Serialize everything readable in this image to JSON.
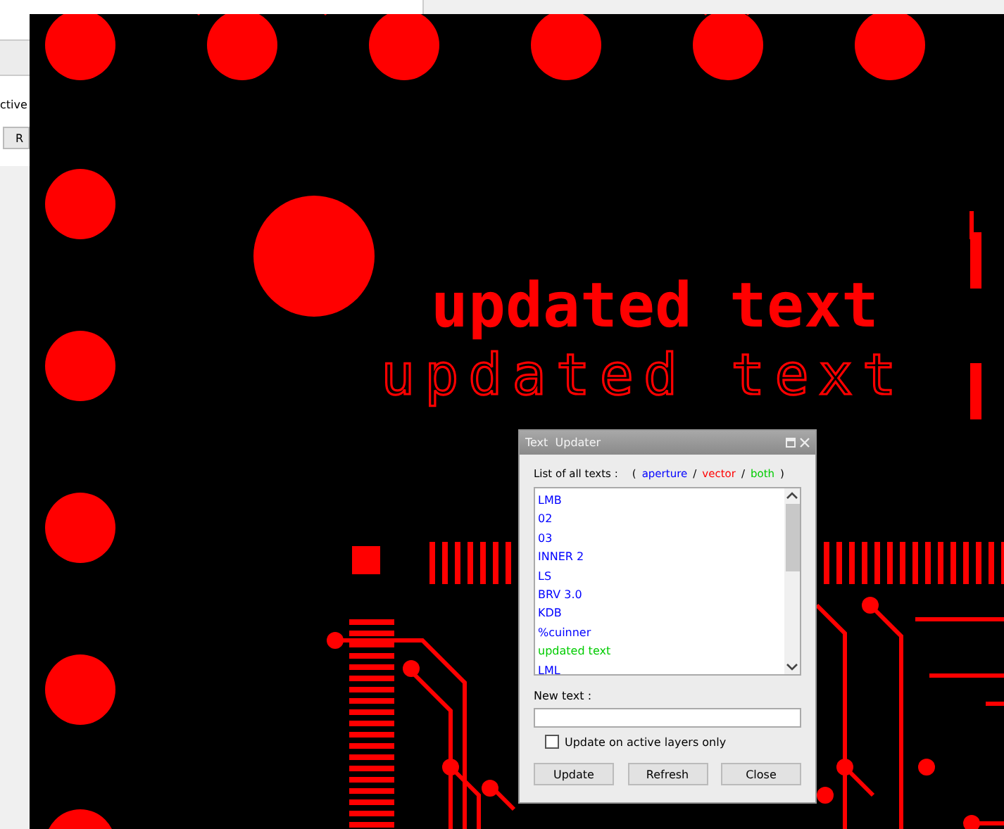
{
  "background_window": {
    "fragments": [
      "ctive",
      "R"
    ]
  },
  "canvas": {
    "texts": [
      {
        "text": "updated text",
        "kind": "bold"
      },
      {
        "text": "updated text",
        "kind": "thin"
      }
    ]
  },
  "dialog": {
    "title": "Text  Updater",
    "list_label": "List of all texts :",
    "legend": [
      {
        "text": "(",
        "kind": "punct"
      },
      {
        "text": "aperture",
        "kind": "word",
        "color": "#0000ff"
      },
      {
        "text": "/",
        "kind": "punct"
      },
      {
        "text": "vector",
        "kind": "word",
        "color": "#ff0000"
      },
      {
        "text": "/",
        "kind": "punct"
      },
      {
        "text": "both",
        "kind": "word",
        "color": "#00cc00"
      },
      {
        "text": ")",
        "kind": "punct"
      }
    ],
    "items": [
      {
        "text": "LMB",
        "color": "#0000ff"
      },
      {
        "text": "02",
        "color": "#0000ff"
      },
      {
        "text": "03",
        "color": "#0000ff"
      },
      {
        "text": "INNER 2",
        "color": "#0000ff"
      },
      {
        "text": "LS",
        "color": "#0000ff"
      },
      {
        "text": "BRV 3.0",
        "color": "#0000ff"
      },
      {
        "text": "KDB",
        "color": "#0000ff"
      },
      {
        "text": "%cuinner",
        "color": "#0000ff"
      },
      {
        "text": "updated text",
        "color": "#00cc00"
      },
      {
        "text": "LML",
        "color": "#0000ff"
      }
    ],
    "new_text_label": "New text :",
    "checkbox": {
      "label": "Update on active layers only",
      "checked": false
    },
    "buttons": [
      "Update",
      "Refresh",
      "Close"
    ]
  }
}
